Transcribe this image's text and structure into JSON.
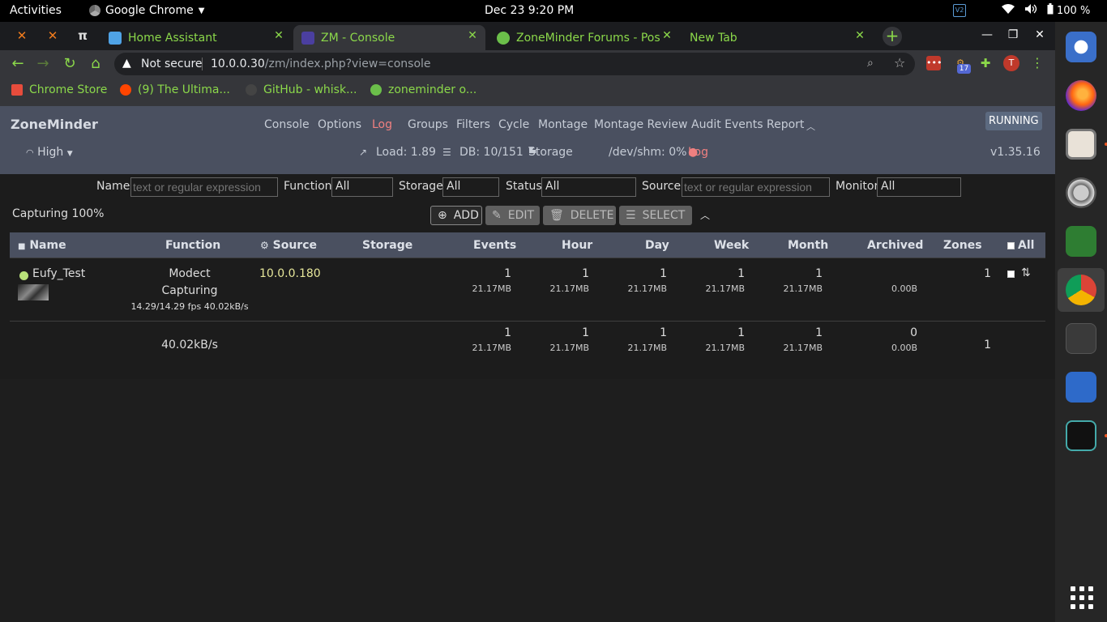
{
  "topbar": {
    "activities": "Activities",
    "app_name": "Google Chrome",
    "clock": "Dec 23  9:20 PM",
    "battery": "100 %",
    "vs_badge": "V2"
  },
  "tabs": [
    {
      "label": "Home Assistant",
      "icon_color": "#4fa3e6",
      "active": false
    },
    {
      "label": "ZM - Console",
      "icon_color": "#4b3fa0",
      "active": true
    },
    {
      "label": "ZoneMinder Forums - Pos",
      "icon_color": "#6bbf4a",
      "active": false
    },
    {
      "label": "New Tab",
      "icon_color": "",
      "active": false
    }
  ],
  "pinned_tabs": [
    "✕",
    "✕",
    "π"
  ],
  "omnibox": {
    "security": "Not secure",
    "host": "10.0.0.30",
    "path": "/zm/index.php?view=console"
  },
  "extensions": {
    "badge": "17",
    "profile_letter": "T"
  },
  "bookmarks": [
    {
      "label": "Chrome Store",
      "icon_color": "#e74c3c"
    },
    {
      "label": "(9) The Ultima...",
      "icon_color": "#ff4500"
    },
    {
      "label": "GitHub - whisk...",
      "icon_color": "#333"
    },
    {
      "label": "zoneminder o...",
      "icon_color": "#6bbf4a"
    }
  ],
  "zm": {
    "brand": "ZoneMinder",
    "nav": [
      "Console",
      "Options",
      "Log",
      "Groups",
      "Filters",
      "Cycle",
      "Montage",
      "Montage Review",
      "Audit Events Report"
    ],
    "state": "RUNNING",
    "bandwidth": "High",
    "load": "Load: 1.89",
    "db": "DB: 10/151",
    "storage": "Storage",
    "shm": "/dev/shm: 0%",
    "log": "Log",
    "version": "v1.35.16"
  },
  "filters": {
    "name_label": "Name",
    "name_placeholder": "text or regular expression",
    "function_label": "Function",
    "function_value": "All",
    "storage_label": "Storage",
    "storage_value": "All",
    "status_label": "Status",
    "status_value": "All",
    "source_label": "Source",
    "source_placeholder": "text or regular expression",
    "monitor_label": "Monitor",
    "monitor_value": "All"
  },
  "toolbar": {
    "capturing": "Capturing 100%",
    "add": "ADD",
    "edit": "EDIT",
    "delete": "DELETE",
    "select": "SELECT"
  },
  "table": {
    "headers": {
      "name": "Name",
      "function": "Function",
      "source": "Source",
      "storage": "Storage",
      "events": "Events",
      "hour": "Hour",
      "day": "Day",
      "week": "Week",
      "month": "Month",
      "archived": "Archived",
      "zones": "Zones",
      "all": "All"
    },
    "monitor": {
      "name": "Eufy_Test",
      "function": "Modect",
      "status": "Capturing",
      "fps": "14.29/14.29 fps 40.02kB/s",
      "source": "10.0.0.180",
      "events": "1",
      "events_size": "21.17MB",
      "hour": "1",
      "hour_size": "21.17MB",
      "day": "1",
      "day_size": "21.17MB",
      "week": "1",
      "week_size": "21.17MB",
      "month": "1",
      "month_size": "21.17MB",
      "archived_size": "0.00B",
      "zones": "1"
    },
    "totals": {
      "bandwidth": "40.02kB/s",
      "events": "1",
      "events_size": "21.17MB",
      "hour": "1",
      "hour_size": "21.17MB",
      "day": "1",
      "day_size": "21.17MB",
      "week": "1",
      "week_size": "21.17MB",
      "month": "1",
      "month_size": "21.17MB",
      "archived": "0",
      "archived_size": "0.00B",
      "zones": "1"
    }
  }
}
